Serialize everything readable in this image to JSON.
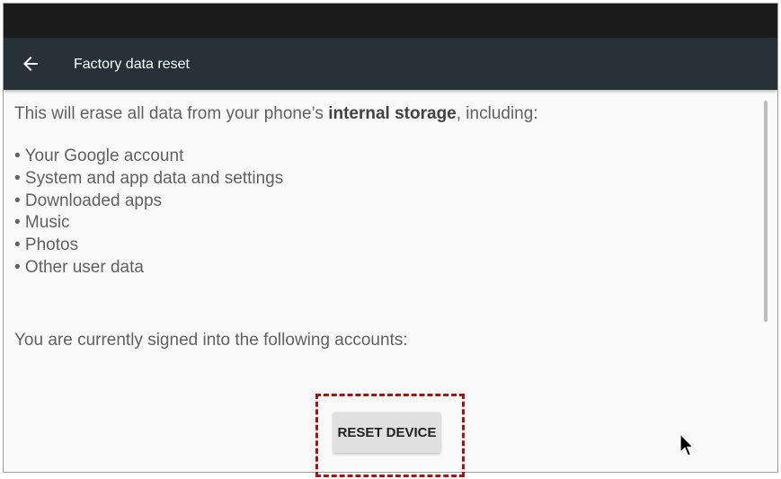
{
  "app_bar": {
    "back_icon": "arrow-back-icon",
    "title": "Factory data reset"
  },
  "content": {
    "intro_prefix": "This will erase all data from your phone’s ",
    "intro_bold": "internal storage",
    "intro_suffix": ", including:",
    "bullets": [
      "• Your Google account",
      "• System and app data and settings",
      "• Downloaded apps",
      "• Music",
      "• Photos",
      "• Other user data"
    ],
    "signed_in_text": "You are currently signed into the following accounts:"
  },
  "actions": {
    "reset_label": "RESET DEVICE"
  },
  "colors": {
    "status_bar": "#1c1c1c",
    "app_bar": "#263238",
    "background": "#fafafa",
    "highlight": "#a31515"
  }
}
